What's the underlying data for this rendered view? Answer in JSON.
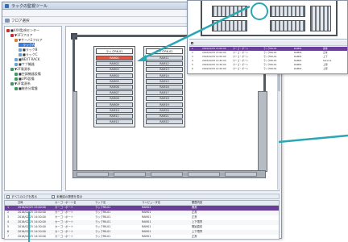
{
  "window": {
    "title": "ラックの監視ツール"
  },
  "menu": [
    "ファイル",
    "表示",
    "操作",
    "設定",
    "ヘルプ"
  ],
  "toolbar": {
    "label": "フロア選択"
  },
  "tree": [
    {
      "label": "■XXX監視センター",
      "indent": 0,
      "color": "#c9302c"
    },
    {
      "label": "▼1F1フロア",
      "indent": 1,
      "color": "#c9302c"
    },
    {
      "label": "▼サーバ1フロア",
      "indent": 2,
      "color": "#e07b39"
    },
    {
      "label": "ラックA",
      "indent": 3,
      "color": "#3a7bd5",
      "selected": true
    },
    {
      "label": "■ラックB",
      "indent": 3,
      "color": "#6ea0d8"
    },
    {
      "label": "■ラックC",
      "indent": 3,
      "color": "#6ea0d8"
    },
    {
      "label": "■NEXT RACK",
      "indent": 2,
      "color": "#6ea0d8"
    },
    {
      "label": "■サブ機器",
      "indent": 2,
      "color": "#6ea0d8"
    },
    {
      "label": "▼2F電源系",
      "indent": 1,
      "color": "#3a9b5c"
    },
    {
      "label": "■空調機器設備",
      "indent": 2,
      "color": "#3a9b5c"
    },
    {
      "label": "■UPS設備",
      "indent": 2,
      "color": "#3a9b5c"
    },
    {
      "label": "▼3F電源系",
      "indent": 1,
      "color": "#3a9b5c"
    },
    {
      "label": "■総合分電盤",
      "indent": 2,
      "color": "#3a9b5c"
    }
  ],
  "racks": [
    {
      "head": "ラックRK-01",
      "slots": [
        {
          "label": "RAM01",
          "alert": true
        },
        {
          "label": "RAM02"
        },
        {
          "label": "RAM03"
        },
        {
          "label": "RAM04"
        },
        {
          "label": "RAM05"
        },
        {
          "label": "RAM06"
        },
        {
          "label": "RAM07"
        },
        {
          "label": "RAM08"
        },
        {
          "label": "RAM09"
        },
        {
          "label": "RAM10"
        },
        {
          "label": "RAM11"
        },
        {
          "label": "RAM12"
        }
      ]
    },
    {
      "head": "ラックRK-02",
      "slots": [
        {
          "label": "RAM11"
        },
        {
          "label": "RAM12"
        },
        {
          "label": "RAM13"
        },
        {
          "label": "RAM14"
        },
        {
          "label": "RAM15"
        },
        {
          "label": "RAM16"
        },
        {
          "label": "RAM17"
        },
        {
          "label": "RAM18"
        },
        {
          "label": "RAM19"
        },
        {
          "label": "RAM20"
        },
        {
          "label": "RAM21"
        },
        {
          "label": "RAM22"
        }
      ]
    }
  ],
  "logbar": {
    "show_all": "すべてのログを表示",
    "unread_only": "未確認の履歴を表示"
  },
  "log_table": {
    "headers": [
      "",
      "日時",
      "カーゴ・ポート名",
      "ラック名",
      "コンピュータ名",
      "履歴内容"
    ],
    "rows": [
      [
        "1",
        "2016/02/25 15:00:00",
        "カーゴ・ポート",
        "ラックRK-01",
        "RAM01",
        "異常"
      ],
      [
        "2",
        "2016/02/25 15:00:00",
        "カーゴ・ポート",
        "ラックRK-01",
        "RAM01",
        "正常"
      ],
      [
        "3",
        "2016/02/25 14:50:00",
        "カーゴ・ポート",
        "ラックRK-01",
        "RAM01",
        "正常"
      ],
      [
        "4",
        "2016/02/25 14:40:00",
        "カーゴ・ポート",
        "ラックRK-01",
        "RAM01",
        "上下限界"
      ],
      [
        "5",
        "2016/02/25 14:30:00",
        "カーゴ・ポート",
        "ラックRK-01",
        "RAM01",
        "開始直前"
      ],
      [
        "6",
        "2016/02/25 14:20:00",
        "カーゴ・ポート",
        "ラックRK-01",
        "RAM01",
        "上下限界"
      ],
      [
        "7",
        "2016/02/25 14:10:00",
        "カーゴ・ポート",
        "ラックRK-01",
        "RAM01",
        "正常"
      ]
    ],
    "selected_index": 0
  },
  "inset_table": {
    "rows": [
      [
        "1",
        "2016/02/25 15:00:00",
        "カーゴ・ポート",
        "ラックRK-01",
        "RAM01",
        "異常"
      ],
      [
        "2",
        "2016/02/25 15:00:00",
        "カーゴ・ポート",
        "ラックRK-01",
        "RAM01",
        "正常"
      ],
      [
        "3",
        "2016/02/25 14:50:00",
        "カーゴ・ポート",
        "ラックRK-01",
        "RAM01",
        "上下"
      ],
      [
        "4",
        "2016/02/25 14:40:00",
        "カーゴ・ポート",
        "ラックRK-01",
        "RAM01",
        "Service"
      ],
      [
        "5",
        "2016/02/25 14:30:00",
        "カーゴ・ポート",
        "ラックRK-01",
        "RAM01",
        "上限"
      ],
      [
        "6",
        "2016/02/25 14:20:00",
        "カーゴ・ポート",
        "ラックRK-01",
        "RAM01",
        "上限"
      ]
    ],
    "selected_index": 0
  },
  "colors": {
    "alert": "#e25a43",
    "selection": "#6a3f9a",
    "callout": "#2aa7b3",
    "tree_selection": "#3a7bd5"
  }
}
